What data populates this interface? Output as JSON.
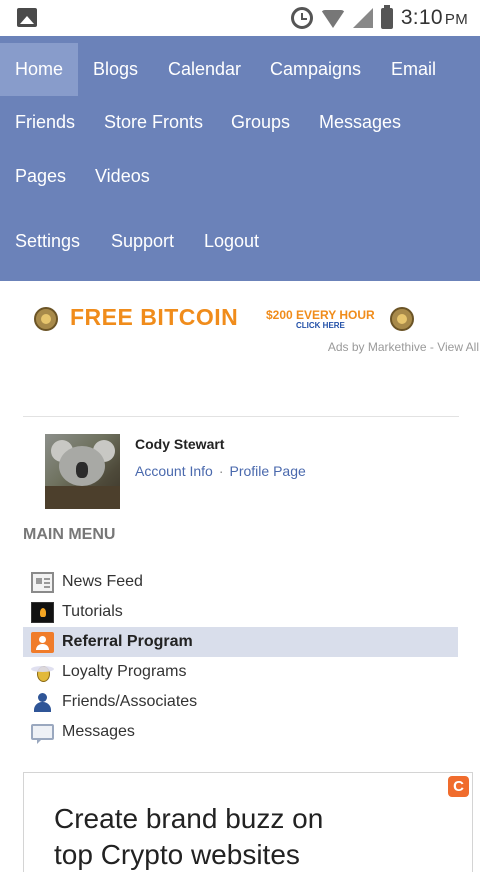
{
  "status_bar": {
    "time": "3:10",
    "ampm": "PM",
    "icons": [
      "image-icon",
      "alarm-icon",
      "wifi-icon",
      "signal-icon",
      "battery-icon"
    ]
  },
  "nav": {
    "items": [
      {
        "label": "Home",
        "active": true
      },
      {
        "label": "Blogs"
      },
      {
        "label": "Calendar"
      },
      {
        "label": "Campaigns"
      },
      {
        "label": "Email"
      },
      {
        "label": "Friends"
      },
      {
        "label": "Store Fronts"
      },
      {
        "label": "Groups"
      },
      {
        "label": "Messages"
      },
      {
        "label": "Pages"
      },
      {
        "label": "Videos"
      },
      {
        "label": "Settings"
      },
      {
        "label": "Support"
      },
      {
        "label": "Logout"
      }
    ],
    "color": "#6b82b9"
  },
  "ad": {
    "title": "FREE BITCOIN",
    "offer": "$200 EVERY HOUR",
    "cta": "CLICK HERE",
    "ads_by": "Ads by Markethive - View All"
  },
  "profile": {
    "name": "Cody Stewart",
    "account_link": "Account Info",
    "separator": "·",
    "profile_link": "Profile Page"
  },
  "main_menu": {
    "heading": "MAIN MENU",
    "items": [
      {
        "label": "News Feed",
        "icon": "news-feed-icon"
      },
      {
        "label": "Tutorials",
        "icon": "tutorials-icon"
      },
      {
        "label": "Referral Program",
        "icon": "referral-icon",
        "selected": true
      },
      {
        "label": "Loyalty Programs",
        "icon": "bee-icon"
      },
      {
        "label": "Friends/Associates",
        "icon": "person-icon"
      },
      {
        "label": "Messages",
        "icon": "message-icon"
      }
    ]
  },
  "promo": {
    "badge": "C",
    "line1": "Create brand buzz on",
    "line2": "top Crypto websites"
  }
}
